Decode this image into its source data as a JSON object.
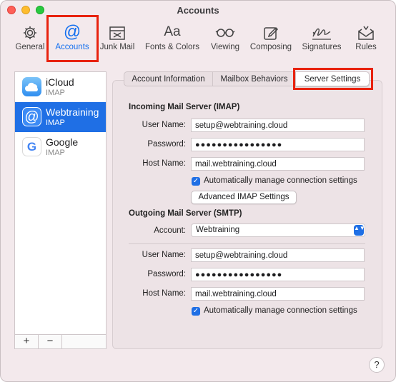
{
  "window": {
    "title": "Accounts"
  },
  "toolbar": {
    "items": [
      {
        "label": "General",
        "icon": "gear-icon"
      },
      {
        "label": "Accounts",
        "icon": "at-sign-icon"
      },
      {
        "label": "Junk Mail",
        "icon": "junk-tray-icon"
      },
      {
        "label": "Fonts & Colors",
        "icon": "font-aa-icon"
      },
      {
        "label": "Viewing",
        "icon": "glasses-icon"
      },
      {
        "label": "Composing",
        "icon": "compose-pencil-icon"
      },
      {
        "label": "Signatures",
        "icon": "signature-icon"
      },
      {
        "label": "Rules",
        "icon": "envelope-rules-icon"
      }
    ],
    "icon_glyphs": {
      "at": "@",
      "font": "Aa"
    }
  },
  "accounts": [
    {
      "name": "iCloud",
      "type": "IMAP",
      "logo": "icloud-logo"
    },
    {
      "name": "Webtraining",
      "type": "IMAP",
      "logo": "at-logo"
    },
    {
      "name": "Google",
      "type": "IMAP",
      "logo": "google-logo"
    }
  ],
  "account_logo_glyphs": {
    "webtraining": "@",
    "google": "G"
  },
  "sidebar_footer": {
    "add": "+",
    "remove": "−"
  },
  "tabs": [
    {
      "label": "Account Information"
    },
    {
      "label": "Mailbox Behaviors"
    },
    {
      "label": "Server Settings"
    }
  ],
  "incoming": {
    "title": "Incoming Mail Server (IMAP)",
    "user_label": "User Name:",
    "user_value": "setup@webtraining.cloud",
    "password_label": "Password:",
    "password_value": "●●●●●●●●●●●●●●●●",
    "host_label": "Host Name:",
    "host_value": "mail.webtraining.cloud",
    "auto_label": "Automatically manage connection settings",
    "advanced_button": "Advanced IMAP Settings"
  },
  "outgoing": {
    "title": "Outgoing Mail Server (SMTP)",
    "account_label": "Account:",
    "account_value": "Webtraining",
    "user_label": "User Name:",
    "user_value": "setup@webtraining.cloud",
    "password_label": "Password:",
    "password_value": "●●●●●●●●●●●●●●●●",
    "host_label": "Host Name:",
    "host_value": "mail.webtraining.cloud",
    "auto_label": "Automatically manage connection settings"
  },
  "glyphs": {
    "checkmark": "✓",
    "select_arrows": "▲▼",
    "help": "?"
  },
  "colors": {
    "accent": "#1f6fe5",
    "highlight": "#e8220e",
    "window_bg": "#f3e9ec"
  }
}
